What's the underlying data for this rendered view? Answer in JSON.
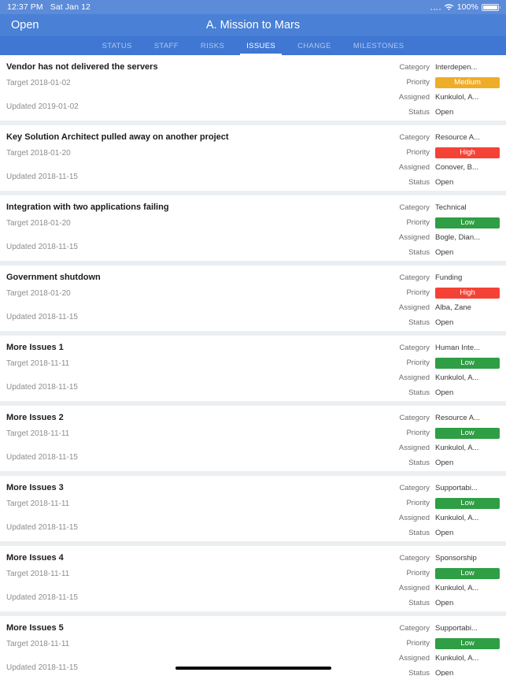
{
  "status_bar": {
    "time": "12:37 PM",
    "date": "Sat Jan 12",
    "battery_percent": "100%",
    "wifi_icon": "wifi-icon",
    "battery_icon": "battery-icon",
    "signal_icon": "signal-dots-icon"
  },
  "nav": {
    "back_label": "Open",
    "title": "A. Mission to Mars"
  },
  "tabs": [
    {
      "label": "STATUS",
      "active": false
    },
    {
      "label": "STAFF",
      "active": false
    },
    {
      "label": "RISKS",
      "active": false
    },
    {
      "label": "ISSUES",
      "active": true
    },
    {
      "label": "CHANGE",
      "active": false
    },
    {
      "label": "MILESTONES",
      "active": false
    }
  ],
  "meta_labels": {
    "category": "Category",
    "priority": "Priority",
    "assigned": "Assigned",
    "status": "Status"
  },
  "priority_colors": {
    "High": "#f44336",
    "Medium": "#eead28",
    "Low": "#2f9e44"
  },
  "theme": {
    "status_bar_bg": "#5b8bd9",
    "nav_bg": "#4a80d6",
    "tab_bg": "#3f77d2",
    "page_bg": "#eceff1",
    "card_bg": "#ffffff"
  },
  "issues": [
    {
      "title": "Vendor has not delivered the servers",
      "target": "Target 2018-01-02",
      "updated": "Updated 2019-01-02",
      "category": "Interdepen...",
      "priority": "Medium",
      "assigned": "Kunkulol, A...",
      "status": "Open"
    },
    {
      "title": "Key Solution Architect pulled away on another project",
      "target": "Target 2018-01-20",
      "updated": "Updated 2018-11-15",
      "category": "Resource A...",
      "priority": "High",
      "assigned": "Conover, B...",
      "status": "Open"
    },
    {
      "title": "Integration with two applications failing",
      "target": "Target 2018-01-20",
      "updated": "Updated 2018-11-15",
      "category": "Technical",
      "priority": "Low",
      "assigned": "Bogle, Dian...",
      "status": "Open"
    },
    {
      "title": "Government shutdown",
      "target": "Target 2018-01-20",
      "updated": "Updated 2018-11-15",
      "category": "Funding",
      "priority": "High",
      "assigned": "Alba, Zane",
      "status": "Open"
    },
    {
      "title": "More Issues 1",
      "target": "Target 2018-11-11",
      "updated": "Updated 2018-11-15",
      "category": "Human Inte...",
      "priority": "Low",
      "assigned": "Kunkulol, A...",
      "status": "Open"
    },
    {
      "title": "More Issues 2",
      "target": "Target 2018-11-11",
      "updated": "Updated 2018-11-15",
      "category": "Resource A...",
      "priority": "Low",
      "assigned": "Kunkulol, A...",
      "status": "Open"
    },
    {
      "title": "More Issues 3",
      "target": "Target 2018-11-11",
      "updated": "Updated 2018-11-15",
      "category": "Supportabi...",
      "priority": "Low",
      "assigned": "Kunkulol, A...",
      "status": "Open"
    },
    {
      "title": "More Issues 4",
      "target": "Target 2018-11-11",
      "updated": "Updated 2018-11-15",
      "category": "Sponsorship",
      "priority": "Low",
      "assigned": "Kunkulol, A...",
      "status": "Open"
    },
    {
      "title": "More Issues 5",
      "target": "Target 2018-11-11",
      "updated": "Updated 2018-11-15",
      "category": "Supportabi...",
      "priority": "Low",
      "assigned": "Kunkulol, A...",
      "status": "Open"
    }
  ]
}
